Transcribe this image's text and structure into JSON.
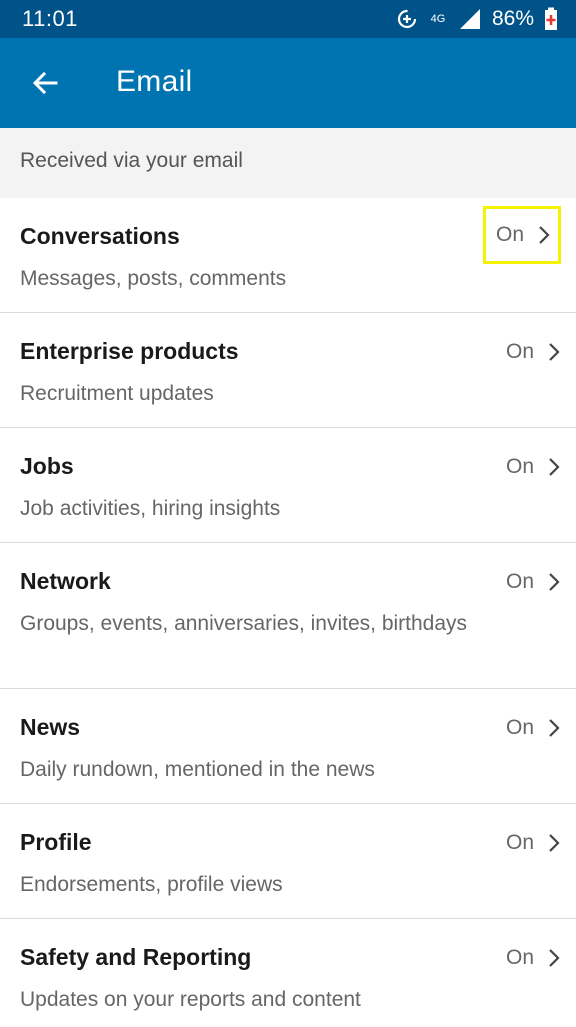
{
  "status_bar": {
    "time": "11:01",
    "network": "4G",
    "battery": "86%"
  },
  "app_bar": {
    "title": "Email"
  },
  "section_header": "Received via your email",
  "rows": [
    {
      "title": "Conversations",
      "subtitle": "Messages, posts, comments",
      "value": "On"
    },
    {
      "title": "Enterprise products",
      "subtitle": "Recruitment updates",
      "value": "On"
    },
    {
      "title": "Jobs",
      "subtitle": "Job activities, hiring insights",
      "value": "On"
    },
    {
      "title": "Network",
      "subtitle": "Groups, events, anniversaries, invites, birthdays",
      "value": "On"
    },
    {
      "title": "News",
      "subtitle": "Daily rundown, mentioned in the news",
      "value": "On"
    },
    {
      "title": "Profile",
      "subtitle": "Endorsements, profile views",
      "value": "On"
    },
    {
      "title": "Safety and Reporting",
      "subtitle": "Updates on your reports and content",
      "value": "On"
    }
  ],
  "colors": {
    "status_bar": "#005389",
    "app_bar": "#0073b1",
    "highlight": "#f4f400"
  }
}
